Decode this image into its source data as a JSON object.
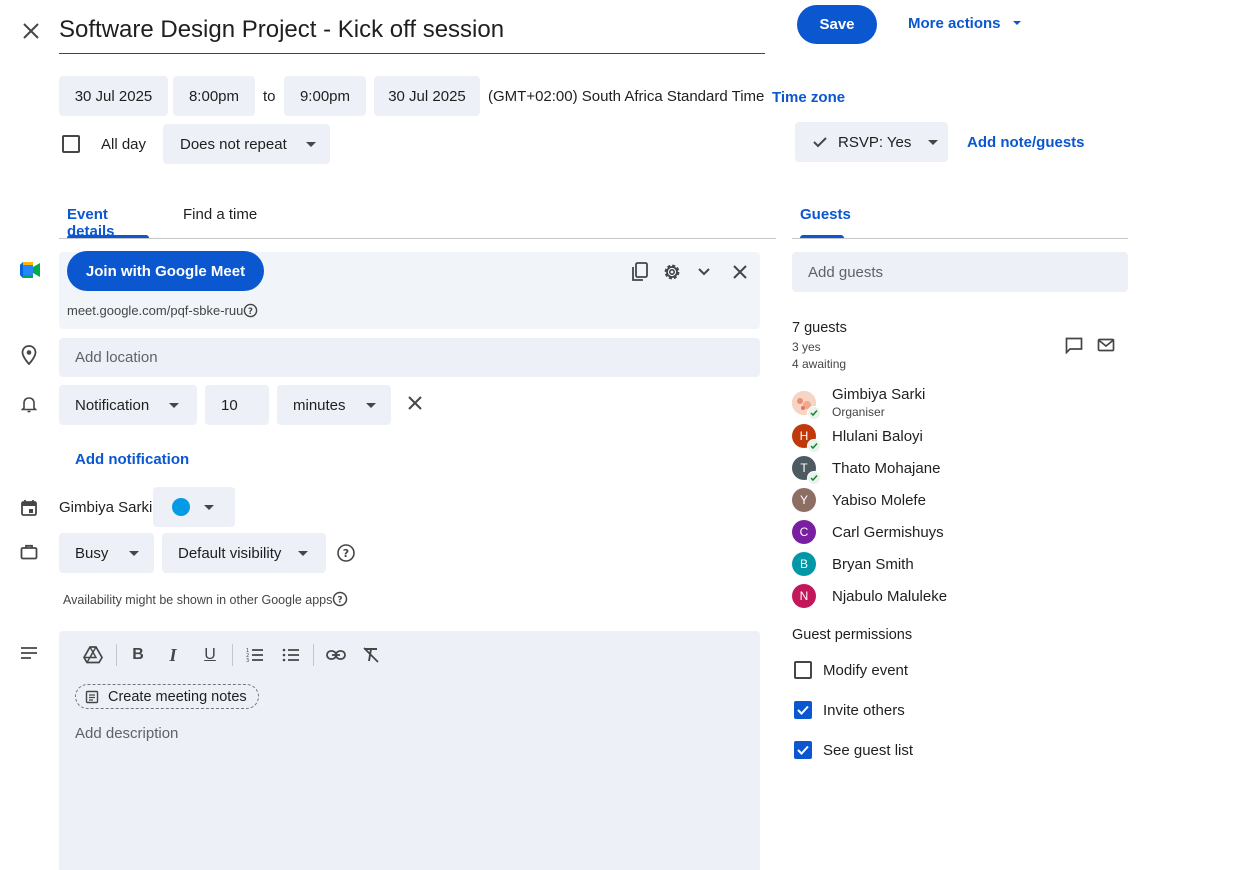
{
  "header": {
    "title": "Software Design Project - Kick off session",
    "save_label": "Save",
    "more_actions_label": "More actions"
  },
  "datetime": {
    "start_date": "30 Jul 2025",
    "start_time": "8:00pm",
    "to_label": "to",
    "end_time": "9:00pm",
    "end_date": "30 Jul 2025",
    "timezone_text": "(GMT+02:00) South Africa Standard Time",
    "timezone_link": "Time zone",
    "all_day_label": "All day",
    "repeat_value": "Does not repeat"
  },
  "rsvp": {
    "value": "RSVP: Yes",
    "add_note_label": "Add note/guests"
  },
  "tabs": {
    "event_details": "Event details",
    "find_a_time": "Find a time",
    "guests": "Guests"
  },
  "meet": {
    "join_label": "Join with Google Meet",
    "link": "meet.google.com/pqf-sbke-ruu"
  },
  "location": {
    "placeholder": "Add location"
  },
  "notification": {
    "type": "Notification",
    "amount": "10",
    "unit": "minutes",
    "add_label": "Add notification"
  },
  "calendar": {
    "owner": "Gimbiya Sarki",
    "color": "#039be5"
  },
  "availability": {
    "status": "Busy",
    "visibility": "Default visibility",
    "note": "Availability might be shown in other Google apps"
  },
  "description": {
    "meeting_notes_label": "Create meeting notes",
    "placeholder": "Add description"
  },
  "guests": {
    "add_placeholder": "Add guests",
    "count": "7 guests",
    "yes_count": "3 yes",
    "awaiting_count": "4 awaiting",
    "list": [
      {
        "name": "Gimbiya Sarki",
        "role": "Organiser",
        "initial": "",
        "color": "#f4c7b5",
        "accepted": true
      },
      {
        "name": "Hlulani Baloyi",
        "role": "",
        "initial": "H",
        "color": "#c0390b",
        "accepted": true
      },
      {
        "name": "Thato Mohajane",
        "role": "",
        "initial": "T",
        "color": "#4d5a62",
        "accepted": true
      },
      {
        "name": "Yabiso Molefe",
        "role": "",
        "initial": "Y",
        "color": "#8d6e63",
        "accepted": false
      },
      {
        "name": "Carl Germishuys",
        "role": "",
        "initial": "C",
        "color": "#7b1fa2",
        "accepted": false
      },
      {
        "name": "Bryan Smith",
        "role": "",
        "initial": "B",
        "color": "#0097a7",
        "accepted": false
      },
      {
        "name": "Njabulo Maluleke",
        "role": "",
        "initial": "N",
        "color": "#c2185b",
        "accepted": false
      }
    ],
    "permissions_title": "Guest permissions",
    "permissions": [
      {
        "label": "Modify event",
        "checked": false
      },
      {
        "label": "Invite others",
        "checked": true
      },
      {
        "label": "See guest list",
        "checked": true
      }
    ]
  },
  "colors": {
    "accent": "#0b57d0",
    "chip_bg": "#edf0f7",
    "meet_panel_bg": "#f1f4f9"
  }
}
